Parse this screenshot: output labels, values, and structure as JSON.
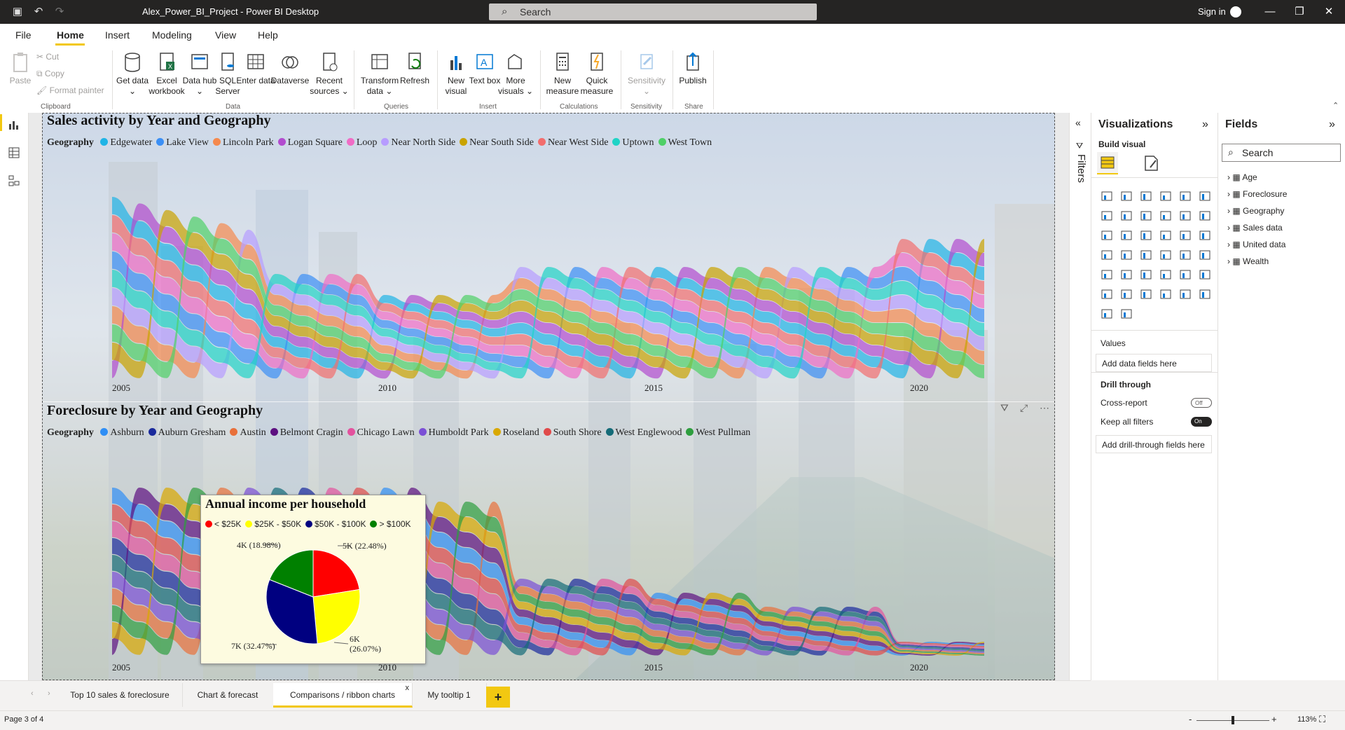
{
  "titlebar": {
    "doc_title": "Alex_Power_BI_Project - Power BI Desktop",
    "search_placeholder": "Search",
    "signin_label": "Sign in"
  },
  "menu": {
    "items": [
      "File",
      "Home",
      "Insert",
      "Modeling",
      "View",
      "Help"
    ],
    "active": "Home"
  },
  "ribbon": {
    "clipboard": {
      "paste": "Paste",
      "cut": "Cut",
      "copy": "Copy",
      "format_painter": "Format painter",
      "group": "Clipboard"
    },
    "data": {
      "get_data": "Get data ⌄",
      "excel": "Excel workbook",
      "data_hub": "Data hub ⌄",
      "sql": "SQL Server",
      "enter": "Enter data",
      "dataverse": "Dataverse",
      "recent": "Recent sources ⌄",
      "group": "Data"
    },
    "queries": {
      "transform": "Transform data ⌄",
      "refresh": "Refresh",
      "group": "Queries"
    },
    "insert": {
      "new_visual": "New visual",
      "text_box": "Text box",
      "more_visuals": "More visuals ⌄",
      "group": "Insert"
    },
    "calculations": {
      "new_measure": "New measure",
      "quick_measure": "Quick measure",
      "group": "Calculations"
    },
    "sensitivity": {
      "label": "Sensitivity ⌄",
      "group": "Sensitivity"
    },
    "share": {
      "publish": "Publish",
      "group": "Share"
    }
  },
  "visual1": {
    "title": "Sales activity by Year and Geography",
    "legend_title": "Geography",
    "legend": [
      {
        "name": "Edgewater",
        "color": "#1fb4e6"
      },
      {
        "name": "Lake View",
        "color": "#3b8ff5"
      },
      {
        "name": "Lincoln Park",
        "color": "#f5894d"
      },
      {
        "name": "Logan Square",
        "color": "#b24ccf"
      },
      {
        "name": "Loop",
        "color": "#f06cc6"
      },
      {
        "name": "Near North Side",
        "color": "#b79cff"
      },
      {
        "name": "Near South Side",
        "color": "#c9a300"
      },
      {
        "name": "Near West Side",
        "color": "#f26d6d"
      },
      {
        "name": "Uptown",
        "color": "#1fd3c6"
      },
      {
        "name": "West Town",
        "color": "#4fd067"
      }
    ],
    "x_ticks": [
      "2005",
      "2010",
      "2015",
      "2020"
    ]
  },
  "visual2": {
    "title": "Foreclosure by Year and Geography",
    "legend_title": "Geography",
    "legend": [
      {
        "name": "Ashburn",
        "color": "#2f8ef5"
      },
      {
        "name": "Auburn Gresham",
        "color": "#1a2a9c"
      },
      {
        "name": "Austin",
        "color": "#e8703a"
      },
      {
        "name": "Belmont Cragin",
        "color": "#5c0f80"
      },
      {
        "name": "Chicago Lawn",
        "color": "#e3529e"
      },
      {
        "name": "Humboldt Park",
        "color": "#7b4fd6"
      },
      {
        "name": "Roseland",
        "color": "#d9a800"
      },
      {
        "name": "South Shore",
        "color": "#e04a4a"
      },
      {
        "name": "West Englewood",
        "color": "#146b78"
      },
      {
        "name": "West Pullman",
        "color": "#2e9e3e"
      }
    ],
    "x_ticks": [
      "2005",
      "2010",
      "2015",
      "2020"
    ]
  },
  "tooltip": {
    "title": "Annual income per household",
    "legend": [
      {
        "name": "< $25K",
        "color": "#ff0000"
      },
      {
        "name": "$25K - $50K",
        "color": "#ffff00"
      },
      {
        "name": "$50K - $100K",
        "color": "#000080"
      },
      {
        "name": "> $100K",
        "color": "#008000"
      }
    ],
    "labels": {
      "red": "5K (22.48%)",
      "yellow_1": "6K",
      "yellow_2": "(26.07%)",
      "navy": "7K (32.47%)",
      "green": "4K (18.98%)"
    }
  },
  "chart_data": {
    "type": "pie",
    "title": "Annual income per household",
    "categories": [
      "< $25K",
      "$25K - $50K",
      "$50K - $100K",
      "> $100K"
    ],
    "values": [
      22.48,
      26.07,
      32.47,
      18.98
    ],
    "value_labels": [
      "5K",
      "6K",
      "7K",
      "4K"
    ],
    "colors": [
      "#ff0000",
      "#ffff00",
      "#000080",
      "#008000"
    ]
  },
  "filters_label": "Filters",
  "viz_pane": {
    "title": "Visualizations",
    "build_visual": "Build visual",
    "values_label": "Values",
    "values_well": "Add data fields here",
    "drill_through": "Drill through",
    "cross_report": "Cross-report",
    "cross_report_state": "Off",
    "keep_filters": "Keep all filters",
    "keep_filters_state": "On",
    "drill_well": "Add drill-through fields here"
  },
  "fields_pane": {
    "title": "Fields",
    "search_placeholder": "Search",
    "items": [
      "Age",
      "Foreclosure",
      "Geography",
      "Sales data",
      "United data",
      "Wealth"
    ]
  },
  "tabs": {
    "items": [
      "Top 10 sales & foreclosure",
      "Chart & forecast",
      "Comparisons / ribbon charts",
      "My tooltip 1"
    ],
    "active": "Comparisons / ribbon charts",
    "add": "+",
    "close": "x"
  },
  "status": {
    "page": "Page 3 of 4",
    "zoom": "113%",
    "zoom_minus": "-",
    "zoom_plus": "+"
  }
}
